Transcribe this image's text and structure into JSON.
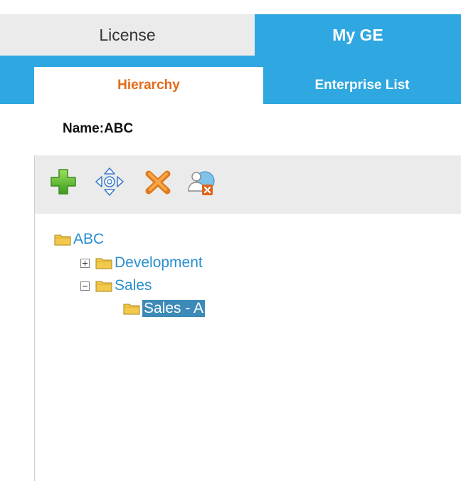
{
  "tabs": {
    "primary": [
      {
        "label": "License",
        "active": false
      },
      {
        "label": "My GE",
        "active": true
      }
    ],
    "secondary": [
      {
        "label": "Hierarchy",
        "active": true
      },
      {
        "label": "Enterprise List",
        "active": false
      }
    ]
  },
  "name_label": "Name:ABC",
  "toolbar": {
    "buttons": [
      {
        "icon": "add-icon"
      },
      {
        "icon": "move-arrows-icon"
      },
      {
        "icon": "delete-x-icon"
      },
      {
        "icon": "remove-user-icon"
      }
    ]
  },
  "tree": {
    "root": {
      "label": "ABC"
    },
    "children": [
      {
        "label": "Development",
        "toggle": "expand"
      },
      {
        "label": "Sales",
        "toggle": "collapse",
        "children": [
          {
            "label": "Sales - A",
            "selected": true
          }
        ]
      }
    ]
  },
  "colors": {
    "accent_blue": "#2fa7e1",
    "tab_inactive": "#ebebeb",
    "active_subtab_text": "#e46b1a",
    "link_blue": "#2a8fce",
    "selection_bg": "#3d8ab9",
    "folder_yellow": "#f2c94c"
  }
}
